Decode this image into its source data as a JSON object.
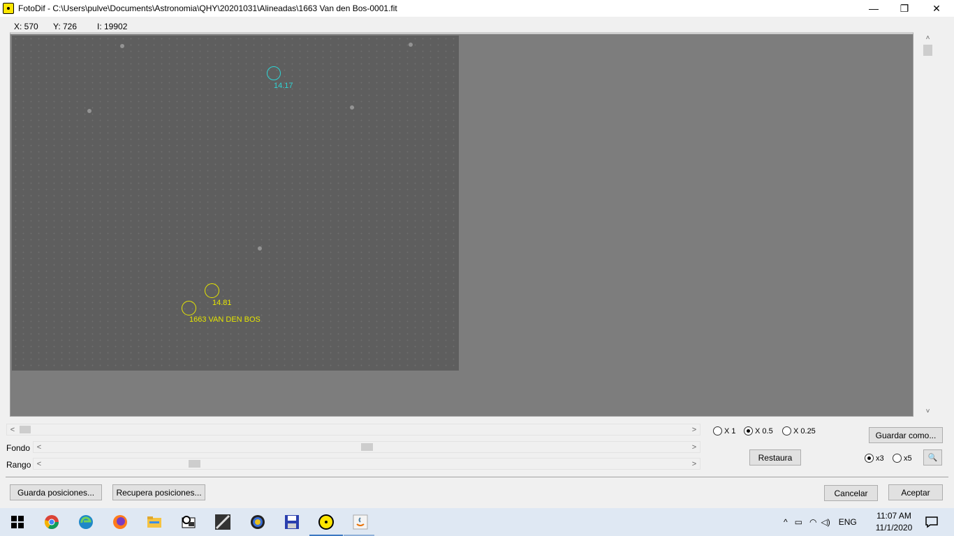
{
  "window": {
    "title": "FotoDif - C:\\Users\\pulve\\Documents\\Astronomia\\QHY\\20201031\\Alineadas\\1663 Van den Bos-0001.fit",
    "minimize": "—",
    "maximize": "❐",
    "close": "✕"
  },
  "readout": {
    "x": "X: 570",
    "y": "Y: 726",
    "i": "I: 19902"
  },
  "markers": [
    {
      "label": "14.17",
      "color": "#2fd5d5"
    },
    {
      "label": "14.81",
      "color": "#e6e600"
    },
    {
      "label": "1663 VAN DEN BOS",
      "color": "#e6e600"
    }
  ],
  "controls": {
    "fondo_label": "Fondo",
    "rango_label": "Rango",
    "left_arrow": "<",
    "right_arrow": ">",
    "up_arrow": "˄",
    "down_arrow": "˅",
    "zoom_x1": "X 1",
    "zoom_x05": "X 0.5",
    "zoom_x025": "X 0.25",
    "mag_x3": "x3",
    "mag_x5": "x5",
    "guardar_como": "Guardar como...",
    "restaura": "Restaura",
    "guarda_posiciones": "Guarda posiciones...",
    "recupera_posiciones": "Recupera posiciones...",
    "cancelar": "Cancelar",
    "aceptar": "Aceptar",
    "magnifier_icon": "🔍"
  },
  "scrollbars": {
    "horizontal_value": 0.02,
    "fondo_value": 0.51,
    "rango_value": 0.24
  },
  "taskbar": {
    "language": "ENG",
    "time": "11:07 AM",
    "date": "11/1/2020"
  }
}
